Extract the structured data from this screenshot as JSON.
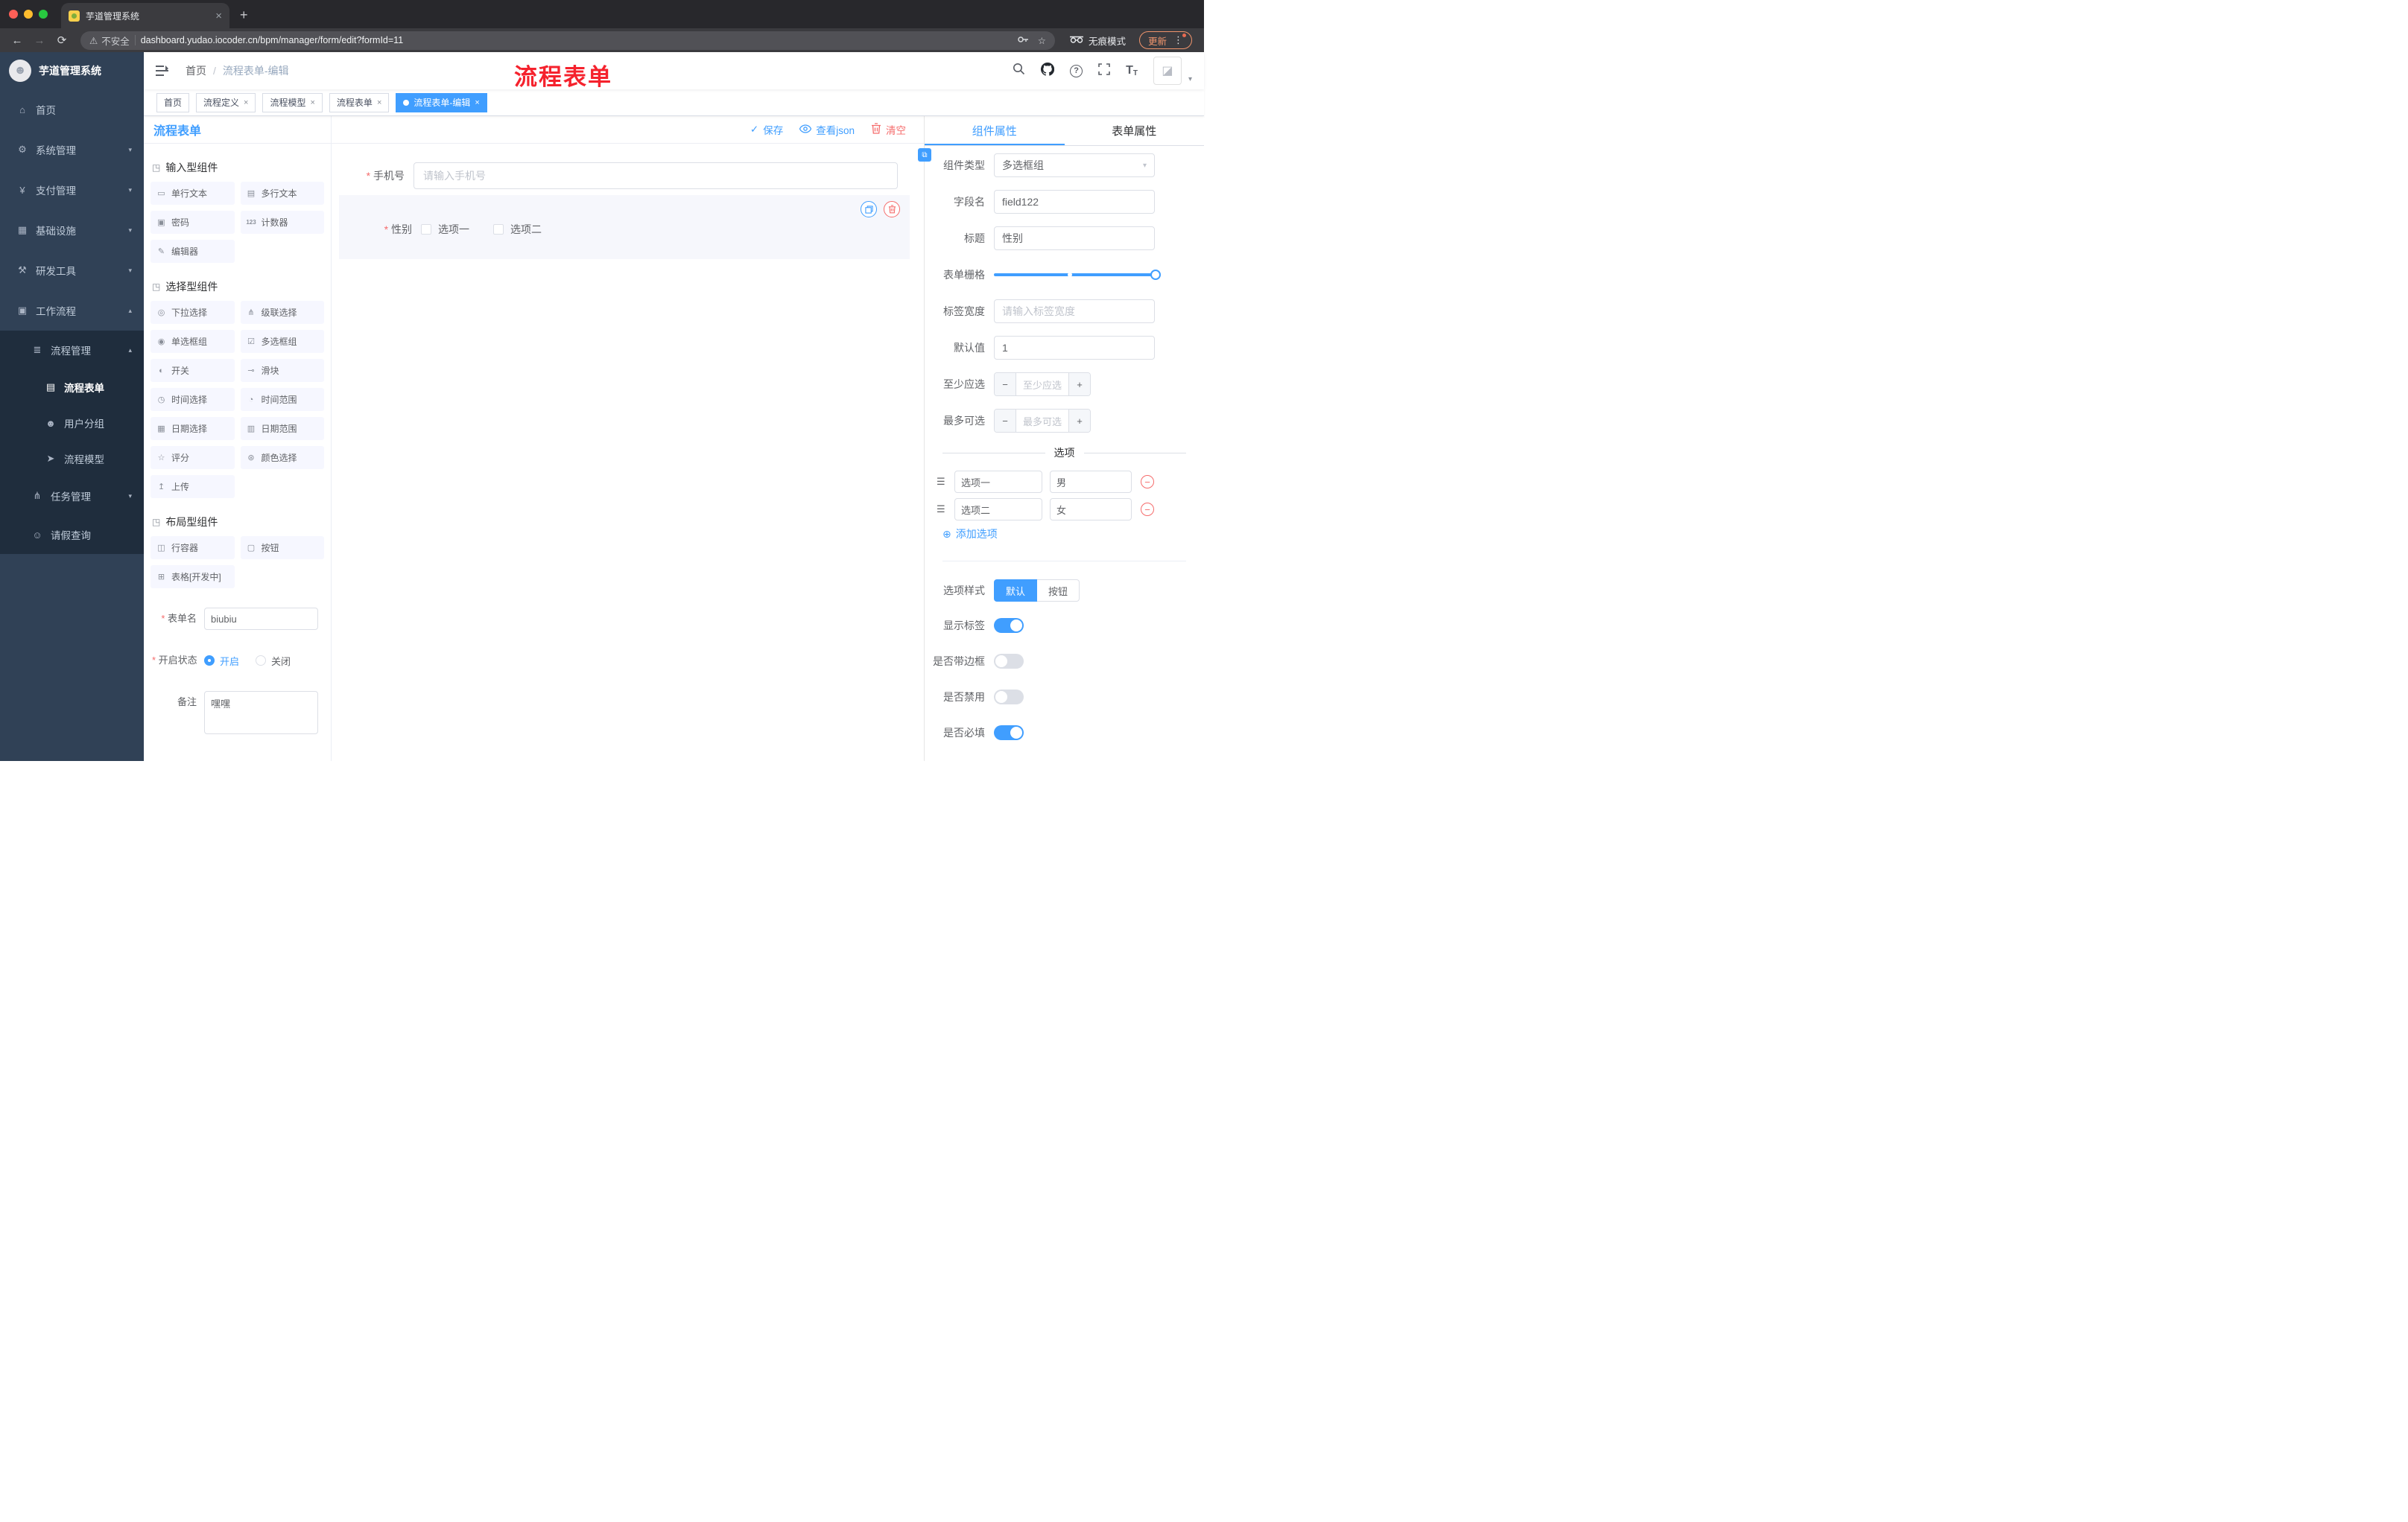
{
  "browser": {
    "tab_title": "芋道管理系统",
    "url": "dashboard.yudao.iocoder.cn/bpm/manager/form/edit?formId=11",
    "security_label": "不安全",
    "incognito_label": "无痕模式",
    "update_label": "更新"
  },
  "icons": {
    "close": "×",
    "new_tab": "+",
    "back": "←",
    "forward": "→",
    "reload": "⟳",
    "warning": "⚠",
    "star": "☆",
    "kebab": "⋮",
    "caret_down": "▾",
    "caret_up": "▴",
    "slash": "/",
    "help": "?",
    "check": "✓",
    "minus": "−",
    "plus": "+",
    "add_circle": "⊕",
    "drag": "☰",
    "section": "◳",
    "link": "⧉",
    "avatar_broken": "◪",
    "logo_face": "☻",
    "font_big": "T",
    "font_small": "T",
    "menu_home": "⌂",
    "menu_system": "⚙",
    "menu_payment": "¥",
    "menu_infra": "▦",
    "menu_dev": "⚒",
    "menu_workflow": "▣",
    "menu_process_mgmt": "≣",
    "menu_process_form": "▤",
    "menu_user_group": "☻",
    "menu_process_model": "➤",
    "menu_task": "⋔",
    "menu_leave": "☺"
  },
  "sidebar": {
    "logo_title": "芋道管理系统",
    "items": [
      {
        "label": "首页"
      },
      {
        "label": "系统管理"
      },
      {
        "label": "支付管理"
      },
      {
        "label": "基础设施"
      },
      {
        "label": "研发工具"
      },
      {
        "label": "工作流程"
      },
      {
        "label": "流程管理"
      },
      {
        "label": "流程表单"
      },
      {
        "label": "用户分组"
      },
      {
        "label": "流程模型"
      },
      {
        "label": "任务管理"
      },
      {
        "label": "请假查询"
      }
    ]
  },
  "navbar": {
    "breadcrumb_home": "首页",
    "breadcrumb_current": "流程表单-编辑",
    "annotation": "流程表单"
  },
  "tags": [
    {
      "label": "首页"
    },
    {
      "label": "流程定义"
    },
    {
      "label": "流程模型"
    },
    {
      "label": "流程表单"
    },
    {
      "label": "流程表单-编辑"
    }
  ],
  "palette": {
    "title": "流程表单",
    "groups": [
      {
        "title": "输入型组件",
        "items": [
          {
            "label": "单行文本",
            "icon": "▭"
          },
          {
            "label": "多行文本",
            "icon": "▤"
          },
          {
            "label": "密码",
            "icon": "▣"
          },
          {
            "label": "计数器",
            "icon": "123"
          },
          {
            "label": "编辑器",
            "icon": "✎"
          }
        ]
      },
      {
        "title": "选择型组件",
        "items": [
          {
            "label": "下拉选择",
            "icon": "◎"
          },
          {
            "label": "级联选择",
            "icon": "⋔"
          },
          {
            "label": "单选框组",
            "icon": "◉"
          },
          {
            "label": "多选框组",
            "icon": "☑"
          },
          {
            "label": "开关",
            "icon": "◐"
          },
          {
            "label": "滑块",
            "icon": "⊸"
          },
          {
            "label": "时间选择",
            "icon": "◷"
          },
          {
            "label": "时间范围",
            "icon": "◔"
          },
          {
            "label": "日期选择",
            "icon": "▦"
          },
          {
            "label": "日期范围",
            "icon": "▥"
          },
          {
            "label": "评分",
            "icon": "☆"
          },
          {
            "label": "颜色选择",
            "icon": "⊛"
          },
          {
            "label": "上传",
            "icon": "↥"
          }
        ]
      },
      {
        "title": "布局型组件",
        "items": [
          {
            "label": "行容器",
            "icon": "◫"
          },
          {
            "label": "按钮",
            "icon": "▢"
          },
          {
            "label": "表格[开发中]",
            "icon": "⊞"
          }
        ]
      }
    ],
    "form": {
      "name_label": "表单名",
      "name_value": "biubiu",
      "status_label": "开启状态",
      "status_on": "开启",
      "status_off": "关闭",
      "remark_label": "备注",
      "remark_value": "嘿嘿"
    }
  },
  "toolbar": {
    "save": "保存",
    "view_json": "查看json",
    "clear": "清空"
  },
  "canvas": {
    "phone": {
      "label": "手机号",
      "placeholder": "请输入手机号"
    },
    "gender": {
      "label": "性别",
      "options": [
        "选项一",
        "选项二"
      ]
    }
  },
  "inspector": {
    "tab_component": "组件属性",
    "tab_form": "表单属性",
    "component_type": {
      "label": "组件类型",
      "value": "多选框组"
    },
    "field_name": {
      "label": "字段名",
      "value": "field122"
    },
    "title": {
      "label": "标题",
      "value": "性别"
    },
    "form_grid": {
      "label": "表单栅格"
    },
    "label_width": {
      "label": "标签宽度",
      "placeholder": "请输入标签宽度"
    },
    "default_value": {
      "label": "默认值",
      "value": "1"
    },
    "min_select": {
      "label": "至少应选",
      "placeholder": "至少应选"
    },
    "max_select": {
      "label": "最多可选",
      "placeholder": "最多可选"
    },
    "options_title": "选项",
    "options": [
      {
        "label": "选项一",
        "value": "男"
      },
      {
        "label": "选项二",
        "value": "女"
      }
    ],
    "add_option": "添加选项",
    "option_style": {
      "label": "选项样式",
      "default": "默认",
      "button": "按钮"
    },
    "show_label": {
      "label": "显示标签",
      "on": true
    },
    "with_border": {
      "label": "是否带边框",
      "on": false
    },
    "disabled": {
      "label": "是否禁用",
      "on": false
    },
    "required": {
      "label": "是否必填",
      "on": true
    }
  },
  "colors": {
    "accent": "#409eff",
    "danger": "#f56c6c",
    "sidebar_bg": "#304156",
    "sidebar_sub_bg": "#1f2d3d"
  }
}
